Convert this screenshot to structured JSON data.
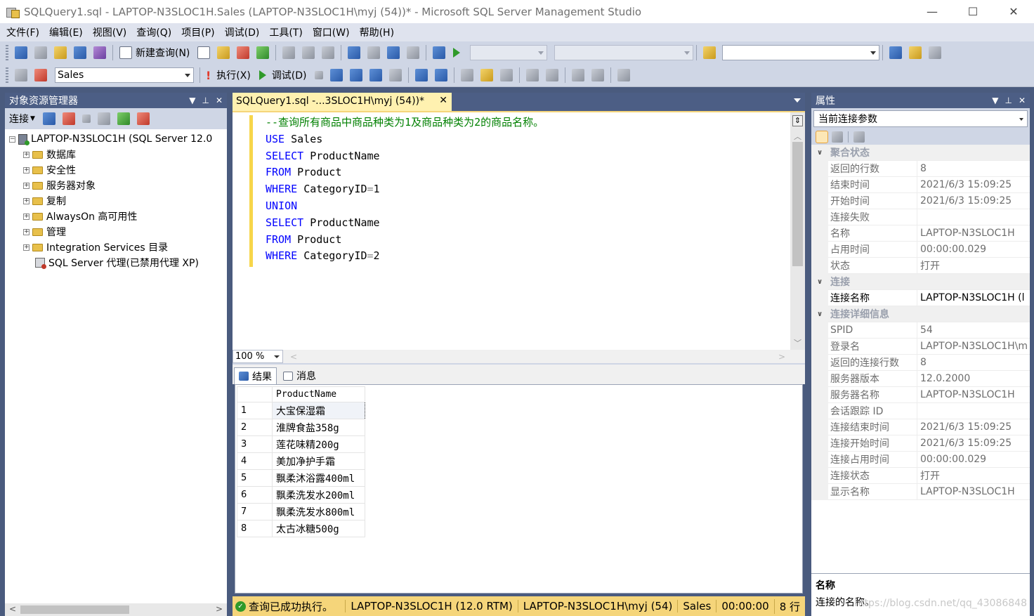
{
  "window": {
    "title": "SQLQuery1.sql - LAPTOP-N3SLOC1H.Sales (LAPTOP-N3SLOC1H\\myj (54))* - Microsoft SQL Server Management Studio",
    "minimize": "—",
    "maximize": "☐",
    "close": "✕"
  },
  "menu": [
    "文件(F)",
    "编辑(E)",
    "视图(V)",
    "查询(Q)",
    "项目(P)",
    "调试(D)",
    "工具(T)",
    "窗口(W)",
    "帮助(H)"
  ],
  "toolbar1": {
    "new_query": "新建查询(N)"
  },
  "toolbar2": {
    "database": "Sales",
    "execute": "执行(X)",
    "debug": "调试(D)"
  },
  "object_explorer": {
    "title": "对象资源管理器",
    "connect": "连接",
    "server": "LAPTOP-N3SLOC1H (SQL Server 12.0",
    "nodes": [
      "数据库",
      "安全性",
      "服务器对象",
      "复制",
      "AlwaysOn 高可用性",
      "管理",
      "Integration Services 目录"
    ],
    "agent": "SQL Server 代理(已禁用代理 XP)"
  },
  "editor": {
    "tab_title": "SQLQuery1.sql -...3SLOC1H\\myj (54))*",
    "comment": "--查询所有商品中商品种类为1及商品种类为2的商品名称。",
    "kw_use": "USE",
    "use_db": "Sales",
    "kw_select": "SELECT",
    "select_col": "ProductName",
    "kw_from": "FROM",
    "from_table": "Product",
    "kw_where": "WHERE",
    "where_col": "CategoryID",
    "eq": "=",
    "val1": "1",
    "kw_union": "UNION",
    "val2": "2",
    "zoom": "100 %"
  },
  "results": {
    "tab_results": "结果",
    "tab_messages": "消息",
    "column": "ProductName",
    "rows": [
      {
        "n": "1",
        "name": "大宝保湿霜"
      },
      {
        "n": "2",
        "name": "淮牌食盐358g"
      },
      {
        "n": "3",
        "name": "莲花味精200g"
      },
      {
        "n": "4",
        "name": "美加净护手霜"
      },
      {
        "n": "5",
        "name": "飘柔沐浴露400ml"
      },
      {
        "n": "6",
        "name": "飘柔洗发水200ml"
      },
      {
        "n": "7",
        "name": "飘柔洗发水800ml"
      },
      {
        "n": "8",
        "name": "太古冰糖500g"
      }
    ]
  },
  "status": {
    "message": "查询已成功执行。",
    "server": "LAPTOP-N3SLOC1H (12.0 RTM)",
    "user": "LAPTOP-N3SLOC1H\\myj (54)",
    "db": "Sales",
    "time": "00:00:00",
    "rows": "8 行"
  },
  "properties": {
    "title": "属性",
    "object": "当前连接参数",
    "sections": [
      {
        "name": "聚合状态",
        "rows": [
          {
            "k": "返回的行数",
            "v": "8"
          },
          {
            "k": "结束时间",
            "v": "2021/6/3 15:09:25"
          },
          {
            "k": "开始时间",
            "v": "2021/6/3 15:09:25"
          },
          {
            "k": "连接失败",
            "v": ""
          },
          {
            "k": "名称",
            "v": "LAPTOP-N3SLOC1H"
          },
          {
            "k": "占用时间",
            "v": "00:00:00.029"
          },
          {
            "k": "状态",
            "v": "打开"
          }
        ]
      },
      {
        "name": "连接",
        "rows": [
          {
            "k": "连接名称",
            "v": "LAPTOP-N3SLOC1H (l",
            "bold": true
          }
        ]
      },
      {
        "name": "连接详细信息",
        "rows": [
          {
            "k": "SPID",
            "v": "54"
          },
          {
            "k": "登录名",
            "v": "LAPTOP-N3SLOC1H\\m"
          },
          {
            "k": "返回的连接行数",
            "v": "8"
          },
          {
            "k": "服务器版本",
            "v": "12.0.2000"
          },
          {
            "k": "服务器名称",
            "v": "LAPTOP-N3SLOC1H"
          },
          {
            "k": "会话跟踪 ID",
            "v": ""
          },
          {
            "k": "连接结束时间",
            "v": "2021/6/3 15:09:25"
          },
          {
            "k": "连接开始时间",
            "v": "2021/6/3 15:09:25"
          },
          {
            "k": "连接占用时间",
            "v": "00:00:00.029"
          },
          {
            "k": "连接状态",
            "v": "打开"
          },
          {
            "k": "显示名称",
            "v": "LAPTOP-N3SLOC1H"
          }
        ]
      }
    ],
    "desc_title": "名称",
    "desc_text": "连接的名称。",
    "watermark": "https://blog.csdn.net/qq_43086848"
  }
}
